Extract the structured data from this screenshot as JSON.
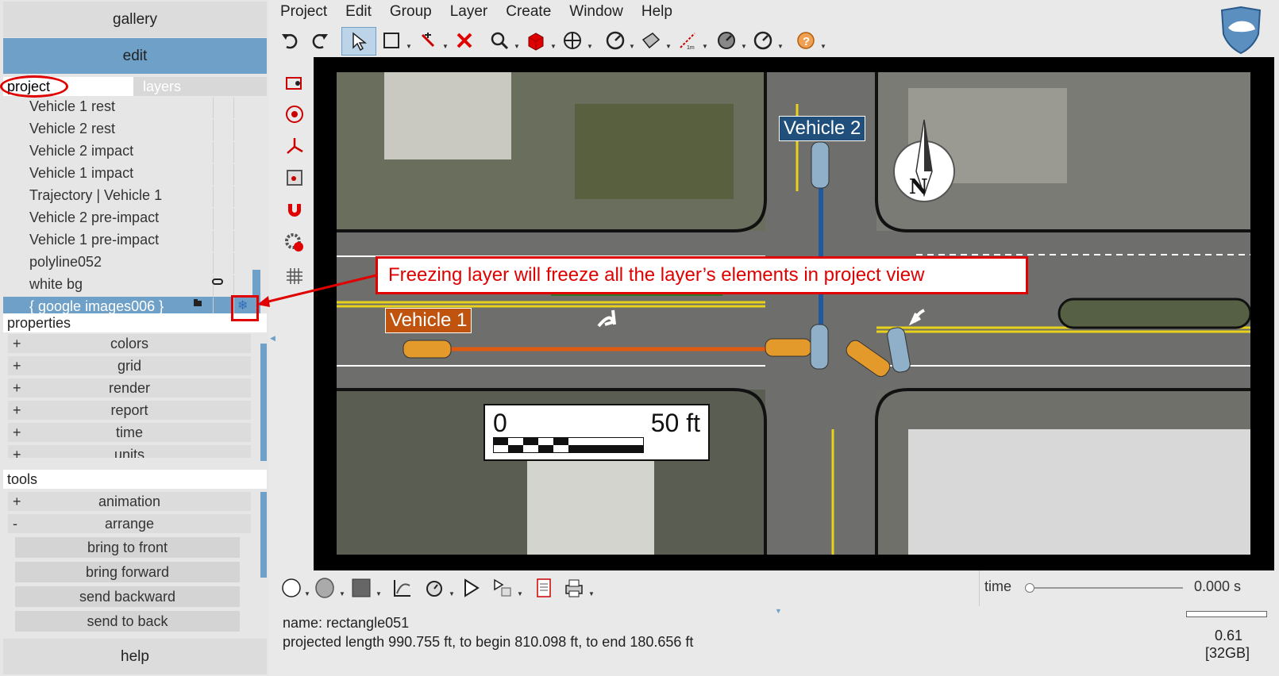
{
  "left_panel": {
    "gallery_label": "gallery",
    "edit_label": "edit",
    "tabs": {
      "project": "project",
      "layers": "layers"
    },
    "layers": [
      {
        "label": "Vehicle 1 rest"
      },
      {
        "label": "Vehicle 2 rest"
      },
      {
        "label": "Vehicle 2 impact"
      },
      {
        "label": "Vehicle 1 impact"
      },
      {
        "label": "Trajectory | Vehicle 1"
      },
      {
        "label": "Vehicle 2 pre-impact"
      },
      {
        "label": "Vehicle 1 pre-impact"
      },
      {
        "label": "polyline052"
      },
      {
        "label": "white bg"
      },
      {
        "label": "{ google images006 }",
        "selected": true
      }
    ],
    "properties_title": "properties",
    "properties": [
      {
        "sign": "+",
        "label": "colors"
      },
      {
        "sign": "+",
        "label": "grid"
      },
      {
        "sign": "+",
        "label": "render"
      },
      {
        "sign": "+",
        "label": "report"
      },
      {
        "sign": "+",
        "label": "time"
      },
      {
        "sign": "+",
        "label": "units"
      }
    ],
    "tools_title": "tools",
    "tools": [
      {
        "sign": "+",
        "label": "animation"
      },
      {
        "sign": "-",
        "label": "arrange"
      }
    ],
    "arrange_buttons": [
      "bring to front",
      "bring forward",
      "send backward",
      "send to back"
    ],
    "help_label": "help"
  },
  "menu": [
    "Project",
    "Edit",
    "Group",
    "Layer",
    "Create",
    "Window",
    "Help"
  ],
  "toolbar_icons": [
    "undo-icon",
    "redo-icon",
    "select-arrow-icon",
    "rectangle-select-icon",
    "wand-icon",
    "delete-x-icon",
    "zoom-icon",
    "red-cube-icon",
    "pan-move-icon",
    "speed-gauge-icon",
    "plane-icon",
    "measure-icon",
    "dial-icon",
    "clock-icon",
    "help-icon"
  ],
  "scene": {
    "vehicle1_label": "Vehicle 1",
    "vehicle2_label": "Vehicle 2",
    "compass_letter": "N",
    "scale_start": "0",
    "scale_end": "50 ft"
  },
  "annotation": {
    "text": "Freezing layer will freeze all the layer’s elements in project view"
  },
  "bottom": {
    "time_label": "time",
    "time_value": "0.000 s",
    "name_text": "name: rectangle051",
    "length_text": "projected length 990.755 ft, to begin 810.098 ft, to end 180.656 ft",
    "zoom_value": "0.61",
    "memory_value": "[32GB]"
  },
  "colors": {
    "accent": "#6fa0c8",
    "annotation": "#e00000",
    "vehicle1": "#c0540f",
    "vehicle2": "#1f4f7a"
  }
}
